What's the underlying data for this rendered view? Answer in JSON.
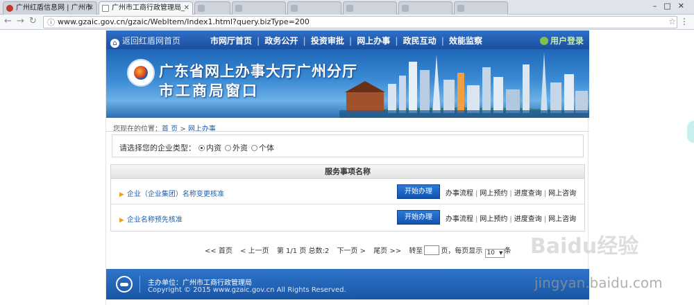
{
  "browser": {
    "tabs": [
      {
        "title": "广州红盾信息网 | 广州市"
      },
      {
        "title": "广州市工商行政管理局_"
      },
      {
        "title": ""
      },
      {
        "title": ""
      },
      {
        "title": ""
      },
      {
        "title": ""
      },
      {
        "title": ""
      },
      {
        "title": ""
      }
    ],
    "url": "www.gzaic.gov.cn/gzaic/WebItem/Index1.html?query.bizType=200"
  },
  "site": {
    "home_link": "返回红盾网首页",
    "nav": [
      "市网厅首页",
      "政务公开",
      "投资审批",
      "网上办事",
      "政民互动",
      "效能监察"
    ],
    "login": "用户登录",
    "banner_line1": "广东省网上办事大厅广州分厅",
    "banner_line2": "市工商局窗口"
  },
  "breadcrumb": {
    "prefix": "您现在的位置：",
    "home": "首 页",
    "sep": " > ",
    "current": "网上办事"
  },
  "enterprise_type": {
    "label": "请选择您的企业类型：",
    "options": [
      "内资",
      "外资",
      "个体"
    ],
    "selected": "内资"
  },
  "services": {
    "header": "服务事项名称",
    "items": [
      {
        "name": "企业（企业集团）名称变更核准"
      },
      {
        "name": "企业名称预先核准"
      }
    ],
    "start_label": "开始办理",
    "links": [
      "办事流程",
      "网上预约",
      "进度查询",
      "网上咨询"
    ]
  },
  "pager": {
    "first": "<< 首页",
    "prev": "< 上一页",
    "page_info": "第 1/1 页",
    "total": "总数:2",
    "next": "下一页 >",
    "last": "尾页 >>",
    "goto_prefix": "转至",
    "goto_suffix": "页，每页显示",
    "page_size": "10",
    "page_size_suffix": "条"
  },
  "footer": {
    "sponsor": "主办单位：广州市工商行政管理局",
    "copyright": "Copyright © 2015 www.gzaic.gov.cn All Rights Reserved."
  },
  "watermark": {
    "line1": "Baidu经验",
    "line2": "jingyan.baidu.com"
  },
  "colors": {
    "nav_blue": "#1a4f9e",
    "link_blue": "#1a5eb0",
    "button_blue": "#1452b0",
    "login_green": "#7ec24c"
  }
}
